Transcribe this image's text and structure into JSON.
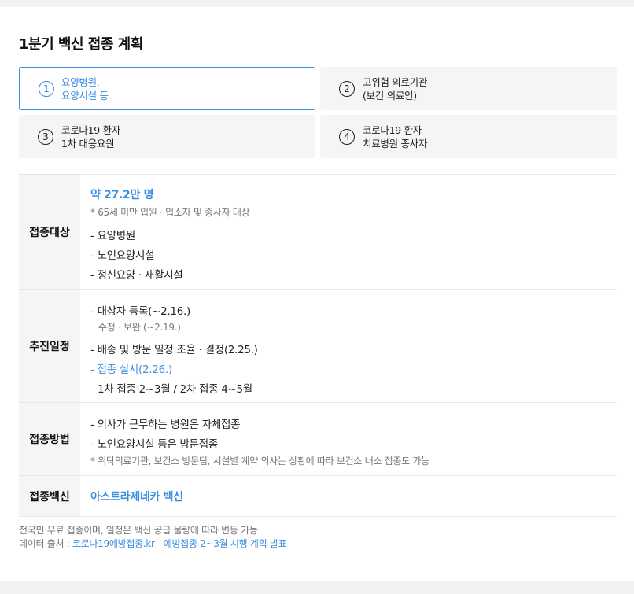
{
  "title": "1분기 백신 접종 계획",
  "phases": [
    {
      "num": "1",
      "line1": "요양병원,",
      "line2": "요양시설 등",
      "active": true
    },
    {
      "num": "2",
      "line1": "고위험 의료기관",
      "line2": "(보건 의료인)",
      "active": false
    },
    {
      "num": "3",
      "line1": "코로나19 환자",
      "line2": "1차 대응요원",
      "active": false
    },
    {
      "num": "4",
      "line1": "코로나19 환자",
      "line2": "치료병원 종사자",
      "active": false
    }
  ],
  "rows": {
    "target": {
      "head": "접종대상",
      "count": "약 27.2만 명",
      "note": "* 65세 미만 입원 · 입소자 및 종사자 대상",
      "items": [
        "- 요양병원",
        "- 노인요양시설",
        "- 정신요양 · 재활시설"
      ]
    },
    "schedule": {
      "head": "추진일정",
      "item1": "- 대상자 등록(~2.16.)",
      "item1_sub": "수정 · 보완 (~2.19.)",
      "item2": "- 배송 및 방문 일정 조율 · 결정(2.25.)",
      "item3": "- 접종 실시(2.26.)",
      "item3_sub": "1차 접종 2~3월 / 2차 접종 4~5월"
    },
    "method": {
      "head": "접종방법",
      "item1": "- 의사가 근무하는 병원은 자체접종",
      "item2": "- 노인요양시설 등은 방문접종",
      "note": "* 위탁의료기관, 보건소 방문팀, 시설별 계약 의사는 상황에 따라 보건소 내소 접종도 가능"
    },
    "vaccine": {
      "head": "접종백신",
      "value": "아스트라제네카 백신"
    }
  },
  "footer": {
    "line1": "전국민 무료 접종이며, 일정은 백신 공급 물량에 따라 변동 가능",
    "source_prefix": "데이터 출처 : ",
    "source_link": "코로나19예방접종.kr - 예방접종 2~3월 시행 계획 발표"
  },
  "colors": {
    "accent": "#3b8de0",
    "head_bg": "#f4f5f7"
  }
}
